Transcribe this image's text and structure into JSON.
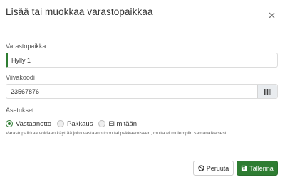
{
  "dialog": {
    "title": "Lisää tai muokkaa varastopaikkaa",
    "close_icon": "close-icon"
  },
  "form": {
    "location_label": "Varastopaikka",
    "location_value": "Hylly 1",
    "barcode_label": "Viivakoodi",
    "barcode_value": "23567876",
    "barcode_icon": "barcode-icon",
    "settings_label": "Asetukset",
    "options": [
      {
        "label": "Vastaanotto",
        "selected": true
      },
      {
        "label": "Pakkaus",
        "selected": false
      },
      {
        "label": "Ei mitään",
        "selected": false
      }
    ],
    "help_text": "Varastopaikkaa voidaan käyttää joko vastaanottoon tai pakkaamiseen, mutta ei molempiin samanaikaisesti."
  },
  "footer": {
    "cancel_label": "Peruuta",
    "cancel_icon": "ban-icon",
    "save_label": "Tallenna",
    "save_icon": "floppy-disk-icon"
  },
  "colors": {
    "accent": "#2e7d32",
    "text": "#333333"
  }
}
